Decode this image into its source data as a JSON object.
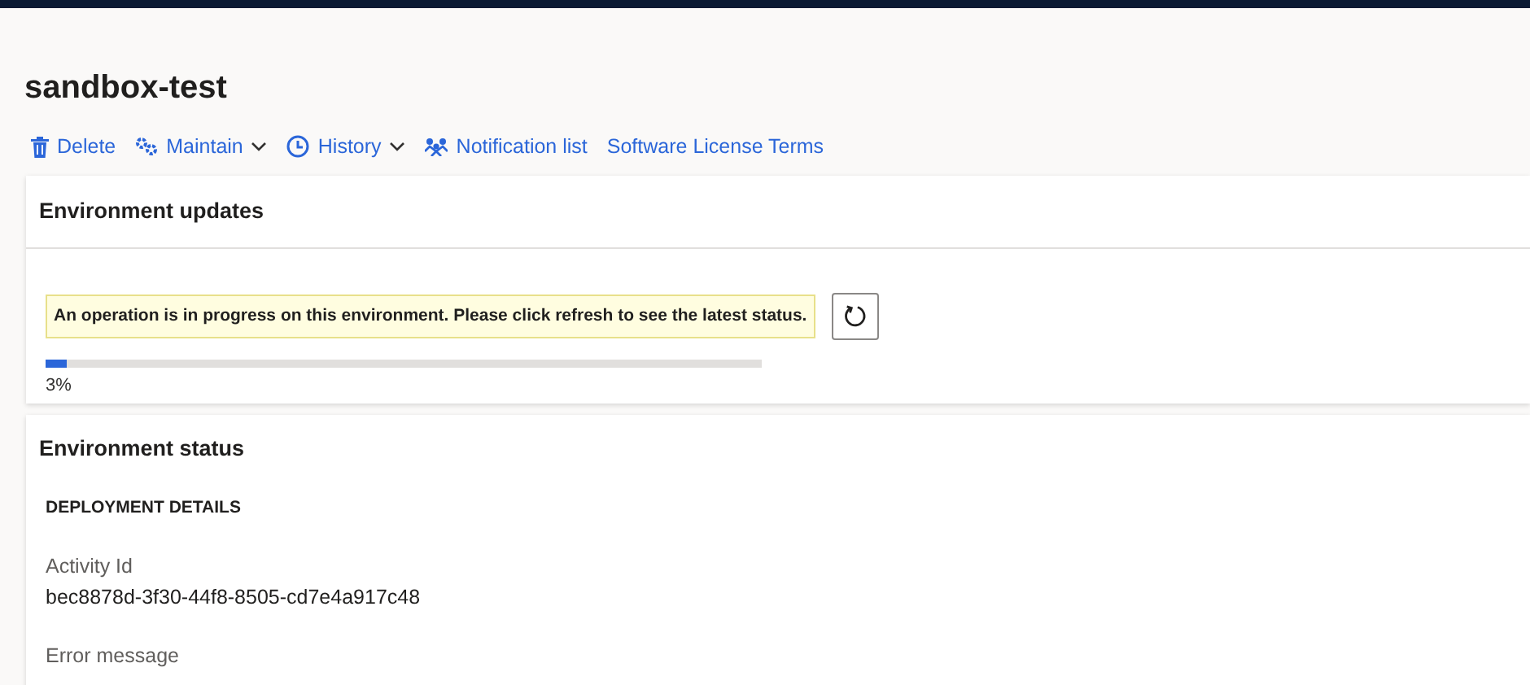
{
  "page": {
    "title": "sandbox-test"
  },
  "toolbar": [
    {
      "label": "Delete",
      "kind": "trash",
      "dropdown": false
    },
    {
      "label": "Maintain",
      "kind": "gears",
      "dropdown": true
    },
    {
      "label": "History",
      "kind": "clock",
      "dropdown": true
    },
    {
      "label": "Notification list",
      "kind": "people",
      "dropdown": false
    },
    {
      "label": "Software License Terms",
      "kind": "plain",
      "dropdown": false
    }
  ],
  "environment_updates": {
    "title": "Environment updates",
    "message": "An operation is in progress on this environment. Please click refresh to see the latest status.",
    "progress": {
      "level": 0.03,
      "reading": "3%"
    }
  },
  "environment_status": {
    "title": "Environment status",
    "section": "DEPLOYMENT DETAILS",
    "fields": [
      {
        "label": "Activity Id",
        "value": "bec8878d-3f30-44f8-8505-cd7e4a917c48"
      },
      {
        "label": "Error message"
      }
    ]
  }
}
